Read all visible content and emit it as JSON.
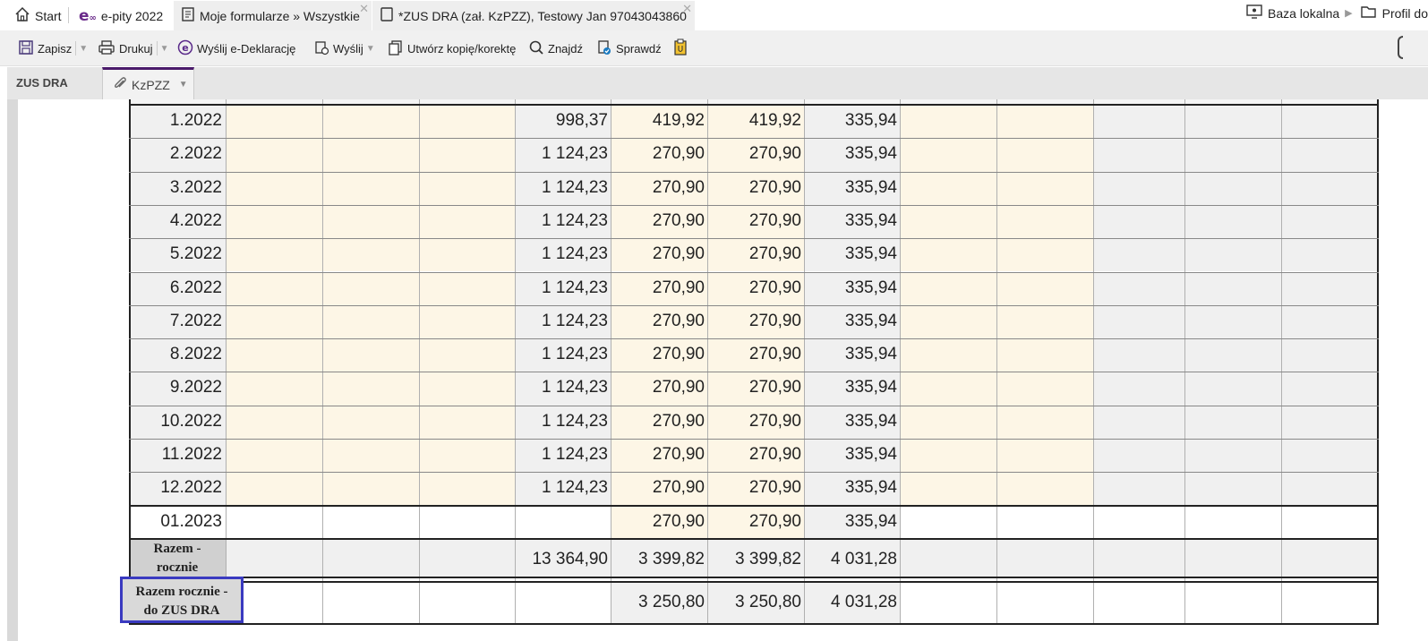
{
  "tabs": [
    {
      "label": "Start",
      "icon": "home-icon"
    },
    {
      "label": "e-pity 2022",
      "icon": "epity-logo-icon"
    },
    {
      "label": "Moje formularze » Wszystkie",
      "icon": "form-icon"
    },
    {
      "label": "*ZUS DRA (zał. KzPZZ), Testowy Jan 97043043860",
      "icon": "document-icon"
    }
  ],
  "right_links": {
    "local_db": "Baza lokalna",
    "profile": "Profil do"
  },
  "toolbar": {
    "save": "Zapisz",
    "print": "Drukuj",
    "send_edecl": "Wyślij e-Deklarację",
    "send": "Wyślij",
    "copy": "Utwórz kopię/korektę",
    "find": "Znajdź",
    "check": "Sprawdź"
  },
  "form_tabs": {
    "section": "ZUS DRA",
    "active": "KzPZZ"
  },
  "table": {
    "rows": [
      {
        "month": "1.2022",
        "c4": "998,37",
        "c5": "419,92",
        "c6": "419,92",
        "c7": "335,94"
      },
      {
        "month": "2.2022",
        "c4": "1 124,23",
        "c5": "270,90",
        "c6": "270,90",
        "c7": "335,94"
      },
      {
        "month": "3.2022",
        "c4": "1 124,23",
        "c5": "270,90",
        "c6": "270,90",
        "c7": "335,94"
      },
      {
        "month": "4.2022",
        "c4": "1 124,23",
        "c5": "270,90",
        "c6": "270,90",
        "c7": "335,94"
      },
      {
        "month": "5.2022",
        "c4": "1 124,23",
        "c5": "270,90",
        "c6": "270,90",
        "c7": "335,94"
      },
      {
        "month": "6.2022",
        "c4": "1 124,23",
        "c5": "270,90",
        "c6": "270,90",
        "c7": "335,94"
      },
      {
        "month": "7.2022",
        "c4": "1 124,23",
        "c5": "270,90",
        "c6": "270,90",
        "c7": "335,94"
      },
      {
        "month": "8.2022",
        "c4": "1 124,23",
        "c5": "270,90",
        "c6": "270,90",
        "c7": "335,94"
      },
      {
        "month": "9.2022",
        "c4": "1 124,23",
        "c5": "270,90",
        "c6": "270,90",
        "c7": "335,94"
      },
      {
        "month": "10.2022",
        "c4": "1 124,23",
        "c5": "270,90",
        "c6": "270,90",
        "c7": "335,94"
      },
      {
        "month": "11.2022",
        "c4": "1 124,23",
        "c5": "270,90",
        "c6": "270,90",
        "c7": "335,94"
      },
      {
        "month": "12.2022",
        "c4": "1 124,23",
        "c5": "270,90",
        "c6": "270,90",
        "c7": "335,94"
      },
      {
        "month": "01.2023",
        "c4": "",
        "c5": "270,90",
        "c6": "270,90",
        "c7": "335,94"
      }
    ],
    "total_annual": {
      "label_line1": "Razem -",
      "label_line2": "rocznie",
      "c4": "13 364,90",
      "c5": "3 399,82",
      "c6": "3 399,82",
      "c7": "4 031,28"
    },
    "total_dra": {
      "label_line1": "Razem rocznie -",
      "label_line2": "do ZUS DRA",
      "c5": "3 250,80",
      "c6": "3 250,80",
      "c7": "4 031,28"
    }
  },
  "colors": {
    "accent": "#4a1a6a",
    "editable_cell": "#fdf6e6",
    "readonly_cell": "#f0f0f0",
    "highlight_border": "#3a3ac0"
  }
}
